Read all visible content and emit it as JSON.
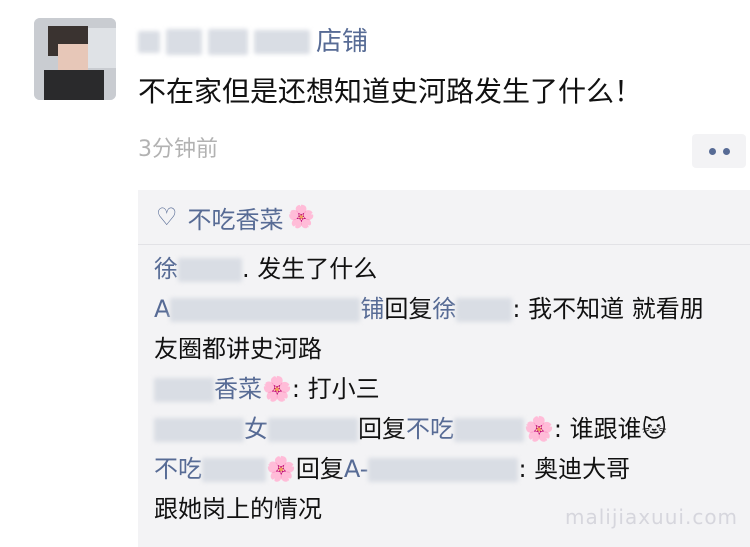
{
  "post": {
    "author_visible": "店铺",
    "text": "不在家但是还想知道史河路发生了什么！",
    "time": "3分钟前"
  },
  "likes": {
    "heart_icon": "heart-outline-icon",
    "name": "不吃香菜",
    "emoji": "🌸"
  },
  "comments": [
    {
      "id": "c1",
      "visible_name": "徐",
      "sep": ". ",
      "text": "发生了什么"
    },
    {
      "id": "c2",
      "visible_name": "A",
      "visible_name_end": "铺",
      "reply_word": "回复",
      "reply_target": "徐",
      "sep": ": ",
      "text_line1": "我不知道 就看朋",
      "text_line2": "友圈都讲史河路"
    },
    {
      "id": "c3",
      "visible_name": "香菜",
      "emoji": "🌸",
      "sep": ": ",
      "text": "打小三"
    },
    {
      "id": "c4",
      "visible_name": "女",
      "reply_word": "回复",
      "reply_target": "不吃",
      "emoji": "🌸",
      "sep": ": ",
      "text": "谁跟谁",
      "emoji_end": "🐱"
    },
    {
      "id": "c5",
      "visible_name": "不吃",
      "emoji": "🌸",
      "reply_word": "回复",
      "reply_target": "A-",
      "sep": ": ",
      "text_line1": "奥迪大哥",
      "text_line2": "跟她岗上的情况"
    }
  ],
  "watermark": "malijiaxuui.com"
}
